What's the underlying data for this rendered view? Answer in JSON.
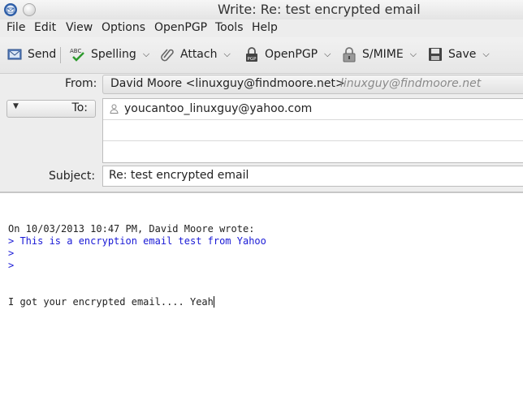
{
  "window": {
    "title": "Write: Re: test encrypted email"
  },
  "menu": [
    "File",
    "Edit",
    "View",
    "Options",
    "OpenPGP",
    "Tools",
    "Help"
  ],
  "toolbar": {
    "send": "Send",
    "spelling": "Spelling",
    "attach": "Attach",
    "openpgp": "OpenPGP",
    "smime": "S/MIME",
    "save": "Save"
  },
  "header": {
    "from_label": "From:",
    "from_value": "David Moore <linuxguy@findmoore.net>",
    "from_alt": "linuxguy@findmoore.net",
    "to_label": "To:",
    "recipients": [
      "youcantoo_linuxguy@yahoo.com",
      "",
      ""
    ],
    "subject_label": "Subject:",
    "subject_value": "Re: test encrypted email"
  },
  "body": {
    "attribution": "On 10/03/2013 10:47 PM, David Moore wrote:",
    "quoted": [
      "> This is a encryption email test from Yahoo",
      ">",
      ">"
    ],
    "reply": "I got your encrypted email.... Yeah"
  }
}
